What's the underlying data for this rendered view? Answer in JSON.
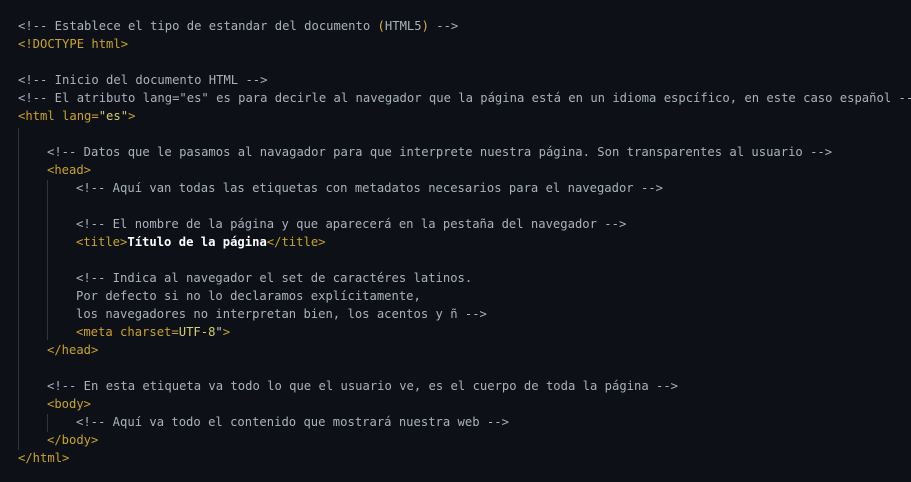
{
  "code": {
    "l1": {
      "pre": "<!-- Establece el tipo de estandar del documento ",
      "paren_open": "(",
      "mid": "HTML5",
      "paren_close": ")",
      "post": " -->"
    },
    "l2": "<!DOCTYPE html>",
    "l4": "<!-- Inicio del documento HTML -->",
    "l5": "<!-- El atributo lang=\"es\" es para decirle al navegador que la página está en un idioma espcífico, en este caso español -->",
    "l6": {
      "open": "<html lang=",
      "value": "\"es\"",
      "close": ">"
    },
    "l8": "<!-- Datos que le pasamos al navagador para que interprete nuestra página. Son transparentes al usuario -->",
    "l9": "<head>",
    "l10": "<!-- Aquí van todas las etiquetas con metadatos necesarios para el navegador -->",
    "l12": "<!-- El nombre de la página y que aparecerá en la pestaña del navegador -->",
    "l13": {
      "open": "<title>",
      "text": "Título de la página",
      "close": "</title>"
    },
    "l15": "<!-- Indica al navegador el set de caractéres latinos.",
    "l16": "Por defecto si no lo declaramos explícitamente,",
    "l17": "los navegadores no interpretan bien, los acentos y ñ -->",
    "l18": {
      "open": "<meta charset=",
      "value": "UTF-8",
      "quote": "\"",
      "close": ">"
    },
    "l19": "</head>",
    "l21": "<!-- En esta etiqueta va todo lo que el usuario ve, es el cuerpo de toda la página -->",
    "l22": "<body>",
    "l23": "<!-- Aquí va todo el contenido que mostrará nuestra web -->",
    "l24": "</body>",
    "l25": "</html>"
  }
}
